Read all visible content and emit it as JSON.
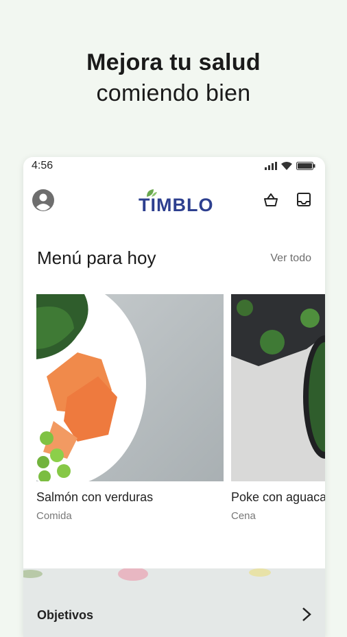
{
  "headline": {
    "line1": "Mejora tu salud",
    "line2": "comiendo bien"
  },
  "status_bar": {
    "time": "4:56",
    "icons": [
      "signal-icon",
      "wifi-icon",
      "battery-icon"
    ]
  },
  "app_bar": {
    "logo_text": "TIMBLO",
    "brand_color": "#2d3f8f",
    "accent_color": "#6aa84f",
    "icons": [
      "profile-icon",
      "basket-icon",
      "inbox-icon"
    ]
  },
  "menu": {
    "title": "Menú para hoy",
    "see_all": "Ver todo",
    "cards": [
      {
        "name": "Salmón con verduras",
        "type": "Comida"
      },
      {
        "name": "Poke con aguacate",
        "type": "Cena"
      }
    ]
  },
  "next_section": {
    "title": "Objetivos"
  }
}
